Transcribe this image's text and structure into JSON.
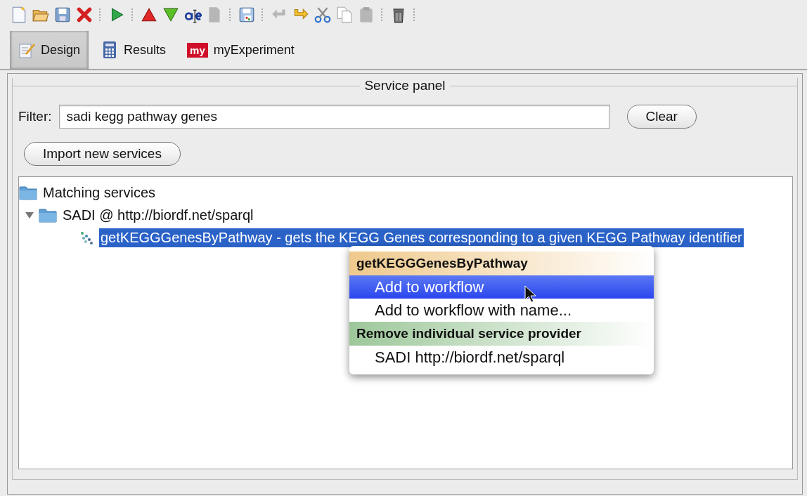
{
  "toolbar": [
    {
      "kind": "new",
      "disabled": false
    },
    {
      "kind": "open",
      "disabled": false
    },
    {
      "kind": "save",
      "disabled": false
    },
    {
      "kind": "close",
      "disabled": false
    },
    {
      "kind": "sep"
    },
    {
      "kind": "run",
      "disabled": false
    },
    {
      "kind": "sep"
    },
    {
      "kind": "up",
      "disabled": false
    },
    {
      "kind": "down",
      "disabled": false
    },
    {
      "kind": "rename",
      "disabled": false
    },
    {
      "kind": "document",
      "disabled": true
    },
    {
      "kind": "sep"
    },
    {
      "kind": "image",
      "disabled": false
    },
    {
      "kind": "sep"
    },
    {
      "kind": "undo",
      "disabled": true
    },
    {
      "kind": "redo",
      "disabled": false
    },
    {
      "kind": "cut",
      "disabled": false
    },
    {
      "kind": "copy",
      "disabled": false
    },
    {
      "kind": "paste",
      "disabled": true
    },
    {
      "kind": "sep"
    },
    {
      "kind": "delete",
      "disabled": false
    },
    {
      "kind": "sep"
    }
  ],
  "tabs": [
    {
      "label": "Design",
      "kind": "design",
      "selected": true
    },
    {
      "label": "Results",
      "kind": "results",
      "selected": false
    },
    {
      "label": "myExperiment",
      "kind": "myexp",
      "badge": "my",
      "selected": false
    }
  ],
  "panel": {
    "title": "Service panel",
    "filter_label": "Filter:",
    "filter_value": "sadi kegg pathway genes",
    "clear_button": "Clear",
    "import_button": "Import new services"
  },
  "tree": [
    {
      "label": "Matching services",
      "kind": "folder",
      "selected": false,
      "children": [
        {
          "label": "SADI @ http://biordf.net/sparql",
          "kind": "folder",
          "expanded": true,
          "selected": false,
          "children": [
            {
              "label": "getKEGGGenesByPathway - gets the KEGG Genes corresponding to a given KEGG Pathway identifier",
              "kind": "service",
              "selected": true
            }
          ]
        }
      ]
    }
  ],
  "context_menu": [
    {
      "header": "getKEGGGenesByPathway",
      "color": "#efc98c",
      "items": [
        {
          "label": "Add to workflow",
          "selected": true
        },
        {
          "label": "Add to workflow with name...",
          "selected": false
        }
      ]
    },
    {
      "header": "Remove individual service provider",
      "color": "#9dc79a",
      "items": [
        {
          "label": "SADI http://biordf.net/sparql",
          "selected": false
        }
      ]
    }
  ]
}
